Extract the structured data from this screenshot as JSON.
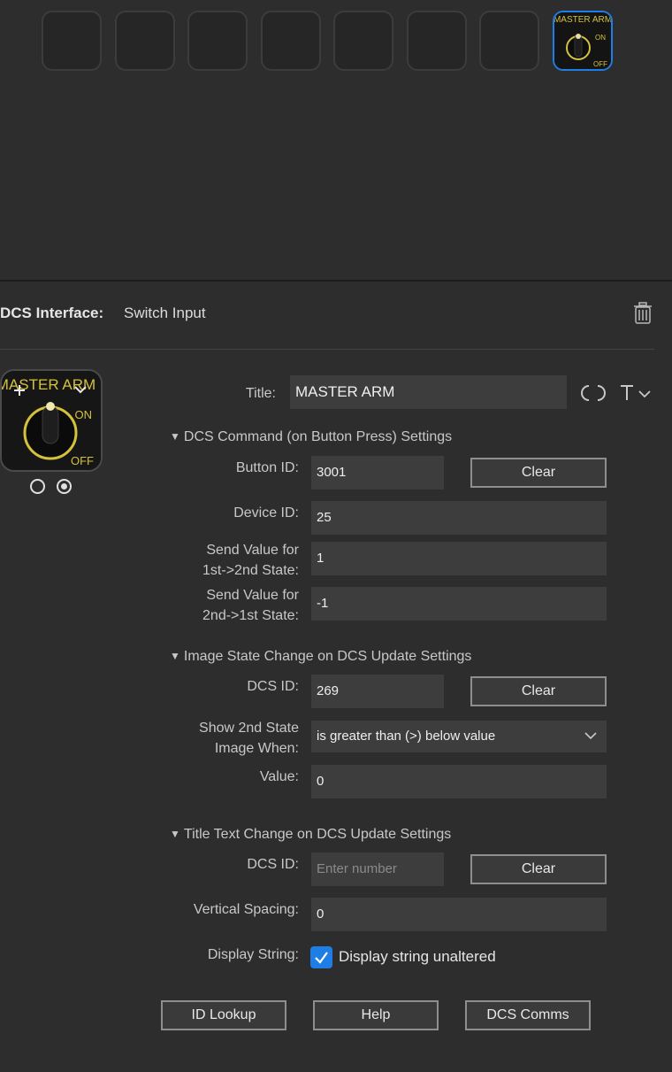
{
  "key_grid": {
    "key_count": 8,
    "selected_key_index": 7,
    "selected_key_image": {
      "label_top": "MASTER ARM",
      "label_on": "ON",
      "label_off": "OFF"
    }
  },
  "interface": {
    "label": "DCS Interface:",
    "value": "Switch Input",
    "delete_icon": "trash-icon"
  },
  "preview": {
    "image_top_text": "MASTER ARM",
    "image_on_text": "ON",
    "image_off_text": "OFF",
    "plus_icon": "plus-icon",
    "chevron_icon": "chevron-down-icon",
    "states": [
      "state-1",
      "state-2"
    ],
    "selected_state": 1
  },
  "title": {
    "label": "Title:",
    "value": "MASTER ARM",
    "sync_icon": "title-sync-icon",
    "text_format_icon": "text-format-icon"
  },
  "command_section": {
    "header": "DCS Command (on Button Press) Settings",
    "button_id_label": "Button ID:",
    "button_id_value": "3001",
    "clear_label": "Clear",
    "device_id_label": "Device ID:",
    "device_id_value": "25",
    "send1_label_line1": "Send Value for",
    "send1_label_line2": "1st->2nd State:",
    "send1_value": "1",
    "send2_label_line1": "Send Value for",
    "send2_label_line2": "2nd->1st State:",
    "send2_value": "-1"
  },
  "image_section": {
    "header": "Image State Change on DCS Update Settings",
    "dcs_id_label": "DCS ID:",
    "dcs_id_value": "269",
    "clear_label": "Clear",
    "show_label_line1": "Show 2nd State",
    "show_label_line2": "Image When:",
    "show_value": "is greater than (>) below value",
    "value_label": "Value:",
    "value_value": "0"
  },
  "title_section": {
    "header": "Title Text Change on DCS Update Settings",
    "dcs_id_label": "DCS ID:",
    "dcs_id_placeholder": "Enter number",
    "clear_label": "Clear",
    "spacing_label": "Vertical Spacing:",
    "spacing_value": "0",
    "display_label": "Display String:",
    "display_checked": true,
    "display_checkbox_label": "Display string unaltered"
  },
  "footer": {
    "id_lookup": "ID Lookup",
    "help": "Help",
    "dcs_comms": "DCS Comms"
  }
}
